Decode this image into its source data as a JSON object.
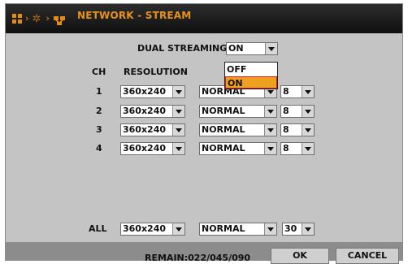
{
  "header": {
    "title": "NETWORK - STREAM",
    "icons": [
      "menu-grid-icon",
      "gear-icon",
      "network-icon"
    ]
  },
  "dual_streaming": {
    "label": "DUAL STREAMING",
    "value": "ON",
    "options": [
      "OFF",
      "ON"
    ],
    "selected_option": "ON"
  },
  "columns": {
    "ch": "CH",
    "resolution": "RESOLUTION"
  },
  "rows": [
    {
      "ch": "1",
      "resolution": "360x240",
      "quality": "NORMAL",
      "fps": "8"
    },
    {
      "ch": "2",
      "resolution": "360x240",
      "quality": "NORMAL",
      "fps": "8"
    },
    {
      "ch": "3",
      "resolution": "360x240",
      "quality": "NORMAL",
      "fps": "8"
    },
    {
      "ch": "4",
      "resolution": "360x240",
      "quality": "NORMAL",
      "fps": "8"
    }
  ],
  "all": {
    "label": "ALL",
    "resolution": "360x240",
    "quality": "NORMAL",
    "fps": "30"
  },
  "footer": {
    "remain": "REMAIN:022/045/090",
    "ok": "OK",
    "cancel": "CANCEL"
  },
  "colors": {
    "accent": "#e8921c",
    "panel": "#c4c4c4",
    "titlebar": "#1a1a1a",
    "highlight": "#f0a020"
  }
}
